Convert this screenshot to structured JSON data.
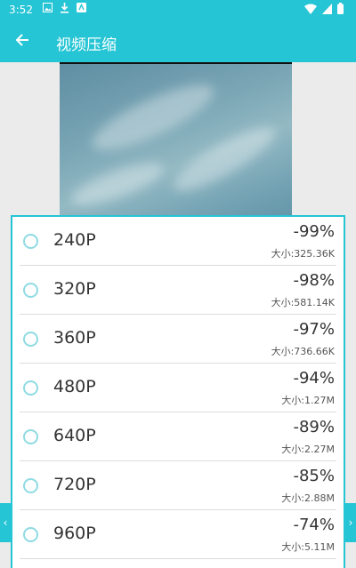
{
  "status": {
    "time": "3:52"
  },
  "header": {
    "title": "视频压缩"
  },
  "options": [
    {
      "resolution": "240P",
      "percent": "-99%",
      "size": "大小:325.36K"
    },
    {
      "resolution": "320P",
      "percent": "-98%",
      "size": "大小:581.14K"
    },
    {
      "resolution": "360P",
      "percent": "-97%",
      "size": "大小:736.66K"
    },
    {
      "resolution": "480P",
      "percent": "-94%",
      "size": "大小:1.27M"
    },
    {
      "resolution": "640P",
      "percent": "-89%",
      "size": "大小:2.27M"
    },
    {
      "resolution": "720P",
      "percent": "-85%",
      "size": "大小:2.88M"
    },
    {
      "resolution": "960P",
      "percent": "-74%",
      "size": "大小:5.11M"
    }
  ],
  "colors": {
    "accent": "#26c5d5",
    "radio": "#8fdbe3"
  },
  "icons": {
    "back": "arrow-left-icon",
    "wifi": "wifi-icon",
    "battery": "battery-icon"
  }
}
